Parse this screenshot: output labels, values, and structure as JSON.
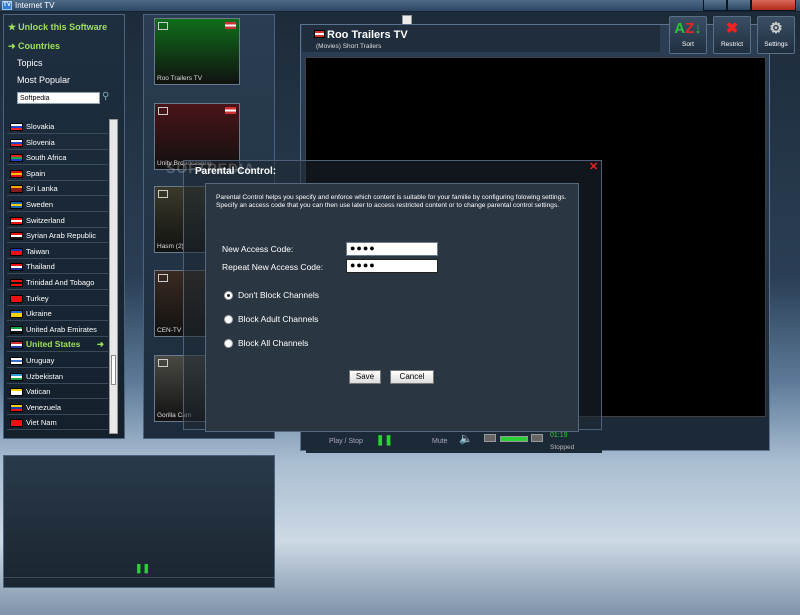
{
  "window": {
    "title": "Internet TV",
    "app_icon": "TV"
  },
  "sidebar": {
    "unlock_label": "Unlock this Software",
    "countries_label": "Countries",
    "topics_label": "Topics",
    "most_popular_label": "Most Popular",
    "search_value": "Softpedia",
    "countries": [
      {
        "name": "Slovakia",
        "flag": [
          "#ffffff",
          "#1f44c9",
          "#e22"
        ]
      },
      {
        "name": "Slovenia",
        "flag": [
          "#ffffff",
          "#1f44c9",
          "#e22"
        ]
      },
      {
        "name": "South Africa",
        "flag": [
          "#e22",
          "#19a648",
          "#1f44c9"
        ]
      },
      {
        "name": "Spain",
        "flag": [
          "#d11",
          "#f6c400",
          "#d11"
        ]
      },
      {
        "name": "Sri Lanka",
        "flag": [
          "#f6a800",
          "#8a1b1b",
          "#8a1b1b"
        ]
      },
      {
        "name": "Sweden",
        "flag": [
          "#1a62b5",
          "#f6d100",
          "#1a62b5"
        ]
      },
      {
        "name": "Switzerland",
        "flag": [
          "#e11",
          "#ffffff",
          "#e11"
        ]
      },
      {
        "name": "Syrian Arab Republic",
        "flag": [
          "#e11",
          "#ffffff",
          "#111"
        ]
      },
      {
        "name": "Taiwan",
        "flag": [
          "#1a3fb5",
          "#e11",
          "#e11"
        ]
      },
      {
        "name": "Thailand",
        "flag": [
          "#e11",
          "#ffffff",
          "#1a2f8f"
        ]
      },
      {
        "name": "Trinidad And Tobago",
        "flag": [
          "#e11",
          "#111",
          "#e11"
        ]
      },
      {
        "name": "Turkey",
        "flag": [
          "#e11",
          "#e11",
          "#e11"
        ]
      },
      {
        "name": "Ukraine",
        "flag": [
          "#1f6fd0",
          "#f6d100",
          "#f6d100"
        ]
      },
      {
        "name": "United Arab Emirates",
        "flag": [
          "#19a648",
          "#ffffff",
          "#111"
        ]
      },
      {
        "name": "United States",
        "flag": [
          "#c33",
          "#ffffff",
          "#1f3f9f"
        ],
        "selected": true
      },
      {
        "name": "Uruguay",
        "flag": [
          "#ffffff",
          "#3a6fd0",
          "#ffffff"
        ]
      },
      {
        "name": "Uzbekistan",
        "flag": [
          "#2d9fd8",
          "#ffffff",
          "#19a648"
        ]
      },
      {
        "name": "Vatican",
        "flag": [
          "#f6d100",
          "#ffffff",
          "#ffffff"
        ]
      },
      {
        "name": "Venezuela",
        "flag": [
          "#f6d100",
          "#1a3fb5",
          "#e11"
        ]
      },
      {
        "name": "Viet Nam",
        "flag": [
          "#e11",
          "#e11",
          "#e11"
        ]
      }
    ]
  },
  "channels": [
    {
      "name": "Roo Trailers TV",
      "bg": "#0f6e1a"
    },
    {
      "name": "Unity Broadcasting",
      "bg": "#4a1418"
    },
    {
      "name": "Hasm (2)",
      "bg": "#3b3a2a"
    },
    {
      "name": "CEN-TV",
      "bg": "#3a2a22"
    },
    {
      "name": "Gorilla Cam",
      "bg": "#4a4a44"
    }
  ],
  "player": {
    "channel_title": "Roo Trailers TV",
    "channel_subtitle": "(Movies) Short Trailers",
    "play_stop_label": "Play / Stop",
    "mute_label": "Mute",
    "time": "01:19",
    "status": "Stopped"
  },
  "toolbar": {
    "sort_label": "Sort",
    "restrict_label": "Restrict",
    "settings_label": "Settings"
  },
  "dialog": {
    "title": "Parental Control:",
    "description": "Parental Control helps you specify and enforce which content is suitable for your familie by configuring folowing settings.\nSpecify an access code that you can then use later to access restricted content or to change parental control settings.",
    "new_code_label": "New Access Code:",
    "new_code_value": "●●●●",
    "repeat_code_label": "Repeat New Access Code:",
    "repeat_code_value": "●●●●",
    "options": [
      {
        "label": "Don't Block Channels",
        "selected": true
      },
      {
        "label": "Block Adult Channels",
        "selected": false
      },
      {
        "label": "Block All Channels",
        "selected": false
      }
    ],
    "save_label": "Save",
    "cancel_label": "Cancel"
  },
  "watermark": "SOFTPEDIA"
}
